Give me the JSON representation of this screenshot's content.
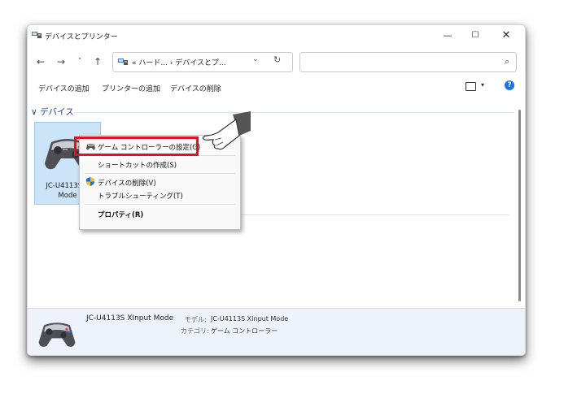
{
  "window": {
    "title": "デバイスとプリンター",
    "controls": {
      "minimize": "—",
      "maximize": "☐",
      "close": "✕"
    }
  },
  "nav": {
    "back": "←",
    "forward": "→",
    "recent": "˅",
    "up": "↑",
    "address": "« ハード... › デバイスとプ...",
    "address_dropdown": "⌄",
    "refresh": "↻",
    "search_value": "",
    "search_icon": "⌕"
  },
  "commands": {
    "add_device": "デバイスの追加",
    "add_printer": "プリンターの追加",
    "remove_device": "デバイスの削除",
    "view_dropdown": "▾",
    "help": "?"
  },
  "group": {
    "chevron": "∨",
    "title": "デバイス"
  },
  "device": {
    "label": "JC-U4113S X\nMode"
  },
  "context_menu": {
    "items": [
      {
        "label": "ゲーム コントローラーの設定(G)",
        "icon": "gamepad-icon"
      },
      {
        "label": "ショートカットの作成(S)"
      },
      {
        "label": "デバイスの削除(V)",
        "icon": "shield-icon"
      },
      {
        "label": "トラブルシューティング(T)"
      },
      {
        "label": "プロパティ(R)"
      }
    ]
  },
  "details": {
    "name": "JC-U4113S XInput Mode",
    "model_key": "モデル:",
    "model_value": "JC-U4113S XInput Mode",
    "category_key": "カテゴリ:",
    "category_value": "ゲーム コントローラー"
  },
  "colors": {
    "highlight": "#e0121c",
    "tile": "#cce4f7",
    "help": "#1a73e8",
    "group": "#1e3f8a"
  }
}
